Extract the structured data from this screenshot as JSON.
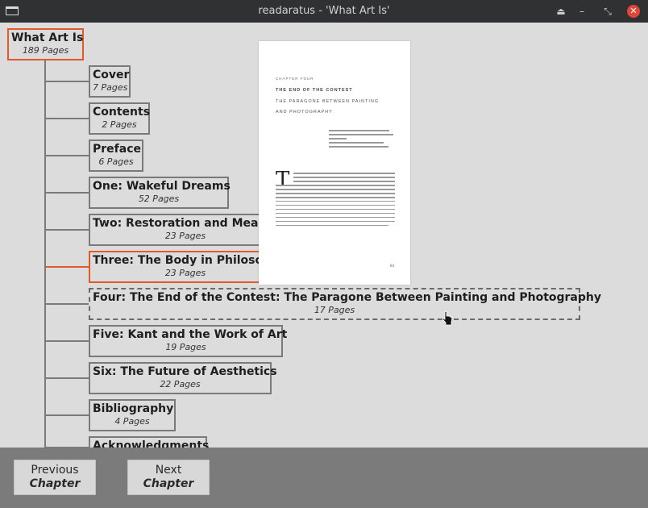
{
  "window": {
    "title": "readaratus - 'What Art Is'"
  },
  "root": {
    "title": "What Art Is",
    "pages": "189 Pages"
  },
  "chapters": [
    {
      "title": "Cover",
      "pages": "7 Pages"
    },
    {
      "title": "Contents",
      "pages": "2 Pages"
    },
    {
      "title": "Preface",
      "pages": "6 Pages"
    },
    {
      "title": "One: Wakeful Dreams",
      "pages": "52 Pages"
    },
    {
      "title": "Two: Restoration and Meani",
      "pages": "23 Pages"
    },
    {
      "title": "Three: The Body in Philosop",
      "pages": "23 Pages"
    },
    {
      "title": "Four: The End of the Contest: The Paragone Between Painting and Photography",
      "pages": "17 Pages"
    },
    {
      "title": "Five: Kant and the Work of Art",
      "pages": "19 Pages"
    },
    {
      "title": "Six: The Future of Aesthetics",
      "pages": "22 Pages"
    },
    {
      "title": "Bibliography",
      "pages": "4 Pages"
    },
    {
      "title": "Acknowledgments",
      "pages": ""
    }
  ],
  "preview": {
    "chapter_label": "CHAPTER FOUR",
    "heading_1": "THE END OF THE CONTEST",
    "heading_2": "THE PARAGONE BETWEEN PAINTING",
    "heading_3": "AND PHOTOGRAPHY",
    "drop_cap": "T",
    "page_number": "84"
  },
  "footer": {
    "previous_line1": "Previous",
    "previous_line2": "Chapter",
    "next_line1": "Next",
    "next_line2": "Chapter"
  },
  "colors": {
    "accent": "#e05a2b",
    "tree_line": "#7a7a7a",
    "footer_bg": "#7b7b7b",
    "close": "#e0463a"
  },
  "icons": [
    "app-icon",
    "eject-icon",
    "minimize-icon",
    "restore-icon",
    "close-icon",
    "mouse-pointer-icon"
  ]
}
